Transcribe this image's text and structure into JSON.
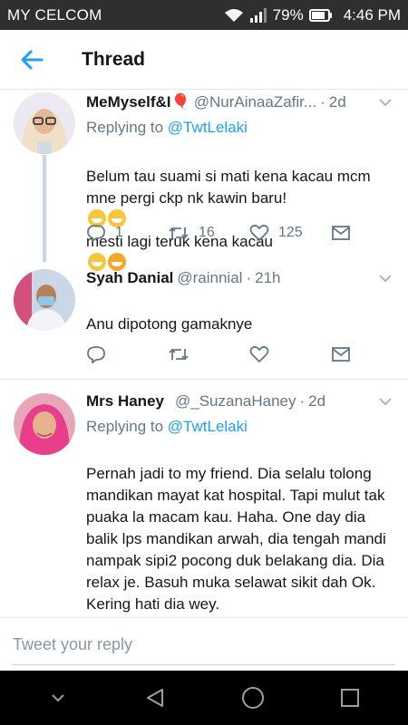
{
  "status_bar": {
    "carrier": "MY CELCOM",
    "battery": "79%",
    "time": "4:46 PM"
  },
  "header": {
    "title": "Thread"
  },
  "tweets": [
    {
      "name": "MeMyself&I🎈",
      "handle": "@NurAinaaZafir...",
      "time": "2d",
      "replying_label": "Replying to",
      "replying_to": "@TwtLelaki",
      "text": "Belum tau suami si mati kena kacau mcm mne pergi ckp nk kawin baru!",
      "text2": "mesti lagi teruk kena kacau",
      "replies": "1",
      "retweets": "16",
      "likes": "125"
    },
    {
      "name": "Syah Danial",
      "handle": "@rainnial",
      "time": "21h",
      "text": "Anu dipotong gamaknye"
    },
    {
      "name": "Mrs Haney",
      "handle": "@_SuzanaHaney",
      "time": "2d",
      "replying_label": "Replying to",
      "replying_to": "@TwtLelaki",
      "text": "Pernah jadi to my friend. Dia selalu tolong mandikan mayat kat hospital. Tapi mulut tak puaka la macam kau. Haha. One day dia balik lps mandikan arwah, dia tengah mandi nampak sipi2 pocong duk belakang dia. Dia relax je. Basuh muka selawat sikit dah Ok. Kering hati dia wey."
    }
  ],
  "dot": "·",
  "compose": {
    "placeholder": "Tweet your reply"
  },
  "colors": {
    "accent": "#1da1f2",
    "muted": "#657786",
    "divider": "#e1e8ed"
  },
  "icons": [
    "wifi-icon",
    "signal-icon",
    "battery-icon",
    "back-arrow-icon",
    "chevron-down-icon",
    "reply-icon",
    "retweet-icon",
    "like-icon",
    "dm-icon",
    "nav-down-icon",
    "nav-back-icon",
    "nav-home-icon",
    "nav-recents-icon"
  ]
}
